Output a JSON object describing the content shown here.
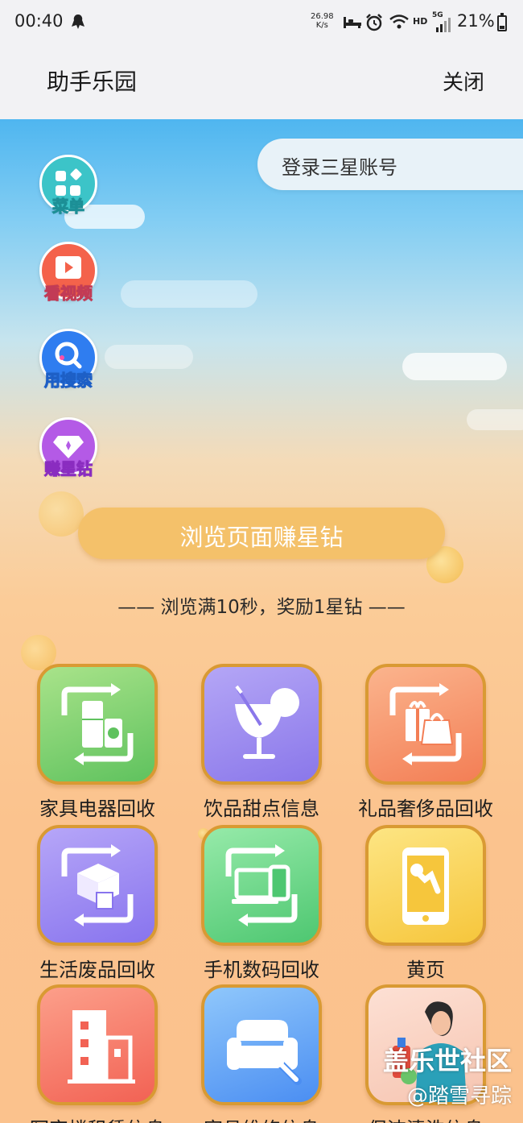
{
  "status": {
    "time": "00:40",
    "speed": "26.98",
    "speed_unit": "K/s",
    "hd": "HD",
    "network": "5G",
    "battery": "21%"
  },
  "header": {
    "title": "助手乐园",
    "close": "关闭"
  },
  "login": {
    "label": "登录三星账号"
  },
  "side_menu": [
    {
      "label": "菜单",
      "icon": "grid-icon",
      "color": "#3cc4c8"
    },
    {
      "label": "看视频",
      "icon": "video-icon",
      "color": "#f4624b"
    },
    {
      "label": "用搜索",
      "icon": "search-icon",
      "color": "#2f7df0"
    },
    {
      "label": "赚星钻",
      "icon": "diamond-icon",
      "color": "#b45ae6"
    }
  ],
  "cta": {
    "label": "浏览页面赚星钻"
  },
  "hint": "—— 浏览满10秒，奖励1星钻 ——",
  "grid": [
    {
      "label": "家具电器回收",
      "icon": "appliance-recycle-icon",
      "colors": [
        "#a9e38a",
        "#5fc25e"
      ]
    },
    {
      "label": "饮品甜点信息",
      "icon": "drink-icon",
      "colors": [
        "#b4a6f6",
        "#8a77ea"
      ]
    },
    {
      "label": "礼品奢侈品回收",
      "icon": "gift-recycle-icon",
      "colors": [
        "#fbb48d",
        "#f37e55"
      ]
    },
    {
      "label": "生活废品回收",
      "icon": "box-recycle-icon",
      "colors": [
        "#b6a6f8",
        "#8874ee"
      ]
    },
    {
      "label": "手机数码回收",
      "icon": "device-recycle-icon",
      "colors": [
        "#96eaa9",
        "#4ec771"
      ]
    },
    {
      "label": "黄页",
      "icon": "phone-wrench-icon",
      "colors": [
        "#fde583",
        "#f6c63c"
      ]
    },
    {
      "label": "写字楼租赁信息",
      "icon": "building-icon",
      "colors": [
        "#fc9f8a",
        "#f26254"
      ]
    },
    {
      "label": "家具维修信息",
      "icon": "sofa-wrench-icon",
      "colors": [
        "#8fc7fb",
        "#4b8ef2"
      ]
    },
    {
      "label": "保洁清洗信息",
      "icon": "cleaner-icon",
      "colors": [
        "#fde0d4",
        "#f6c5b1"
      ]
    }
  ],
  "watermark": {
    "line1": "盖乐世社区",
    "line2": "@踏雪寻踪"
  }
}
